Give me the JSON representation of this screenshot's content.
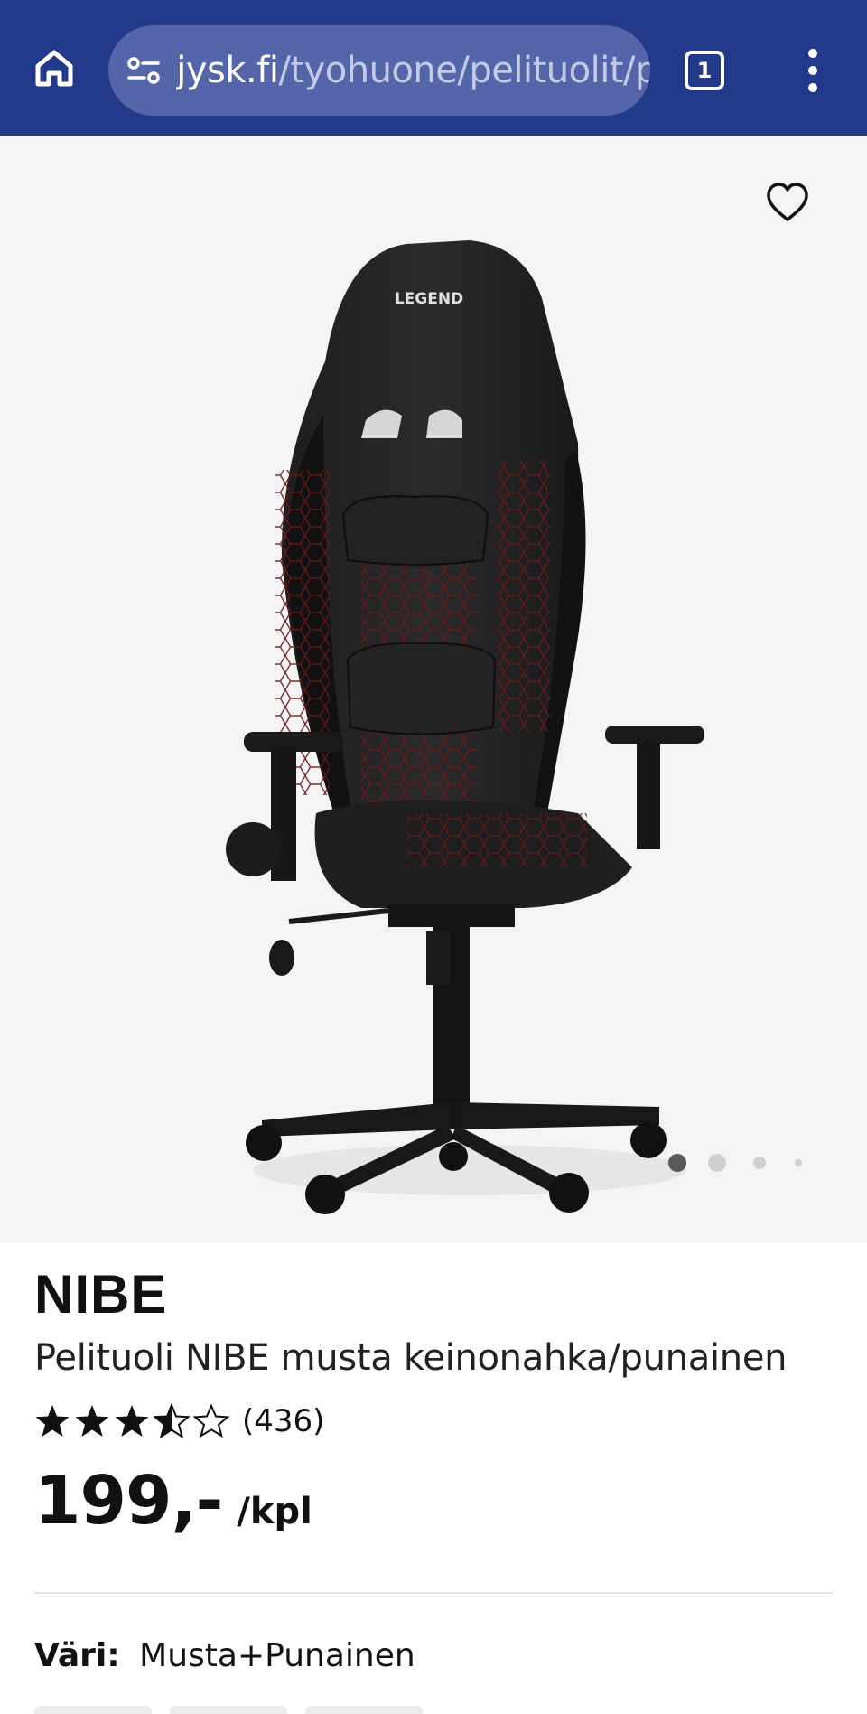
{
  "browser": {
    "url_host": "jysk.fi",
    "url_path": "/tyohuone/pelituolit/pe",
    "tab_count": "1"
  },
  "gallery": {
    "chair_brand_text": "LEGEND",
    "slide_count": 4,
    "active_slide": 1
  },
  "product": {
    "brand": "NIBE",
    "name": "Pelituoli NIBE musta keinonahka/punainen",
    "rating_value": 3.5,
    "rating_max": 5,
    "review_count": "(436)",
    "price": "199,-",
    "price_unit": "/kpl",
    "color_label": "Väri:",
    "color_value": "Musta+Punainen"
  },
  "colors": {
    "toolbar": "#233a8a",
    "urlbar": "#5565a9",
    "gallery_bg": "#f4f4f4",
    "accent_red": "#b31b1b"
  }
}
